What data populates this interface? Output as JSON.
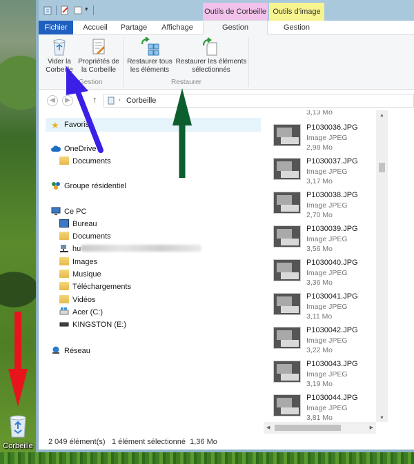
{
  "window": {
    "context_tabs": {
      "corbeille": "Outils de Corbeille",
      "image": "Outils d'image"
    },
    "tabs": [
      {
        "label": "Fichier"
      },
      {
        "label": "Accueil"
      },
      {
        "label": "Partage"
      },
      {
        "label": "Affichage"
      },
      {
        "label": "Gestion"
      },
      {
        "label": "Gestion"
      }
    ]
  },
  "ribbon": {
    "empty_line1": "Vider la",
    "empty_line2": "Corbeille",
    "props_line1": "Propriétés de",
    "props_line2": "la Corbeille",
    "restore_all_line1": "Restaurer tous",
    "restore_all_line2": "les éléments",
    "restore_sel_line1": "Restaurer les éléments",
    "restore_sel_line2": "sélectionnés",
    "group_gestion": "Gestion",
    "group_restaurer": "Restaurer"
  },
  "address": {
    "path": "Corbeille"
  },
  "nav": {
    "favoris": "Favoris",
    "onedrive": "OneDrive",
    "documents1": "Documents",
    "groupe": "Groupe résidentiel",
    "cepc": "Ce PC",
    "bureau": "Bureau",
    "documents2": "Documents",
    "user_prefix": "hu",
    "images": "Images",
    "musique": "Musique",
    "telechargements": "Téléchargements",
    "videos": "Vidéos",
    "acer": "Acer (C:)",
    "kingston": "KINGSTON (E:)",
    "reseau": "Réseau"
  },
  "files": {
    "partial_size": "3,13 Mo",
    "items": [
      {
        "name": "P1030036.JPG",
        "type": "Image JPEG",
        "size": "2,98 Mo"
      },
      {
        "name": "P1030037.JPG",
        "type": "Image JPEG",
        "size": "3,17 Mo"
      },
      {
        "name": "P1030038.JPG",
        "type": "Image JPEG",
        "size": "2,70 Mo"
      },
      {
        "name": "P1030039.JPG",
        "type": "Image JPEG",
        "size": "3,56 Mo"
      },
      {
        "name": "P1030040.JPG",
        "type": "Image JPEG",
        "size": "3,36 Mo"
      },
      {
        "name": "P1030041.JPG",
        "type": "Image JPEG",
        "size": "3,11 Mo"
      },
      {
        "name": "P1030042.JPG",
        "type": "Image JPEG",
        "size": "3,22 Mo"
      },
      {
        "name": "P1030043.JPG",
        "type": "Image JPEG",
        "size": "3,19 Mo"
      },
      {
        "name": "P1030044.JPG",
        "type": "Image JPEG",
        "size": "3,81 Mo"
      }
    ]
  },
  "status": {
    "count": "2 049 élément(s)",
    "selection": "1 élément sélectionné  1,36 Mo"
  },
  "desktop": {
    "bin_label": "Corbeille"
  },
  "colors": {
    "file_tab": "#1f5fbf",
    "ctx_corbeille": "#f3c2ec",
    "ctx_image": "#f7f38f",
    "arrow_blue": "#3a1fe6",
    "arrow_green": "#0d5e2e",
    "arrow_red": "#e8141b"
  }
}
